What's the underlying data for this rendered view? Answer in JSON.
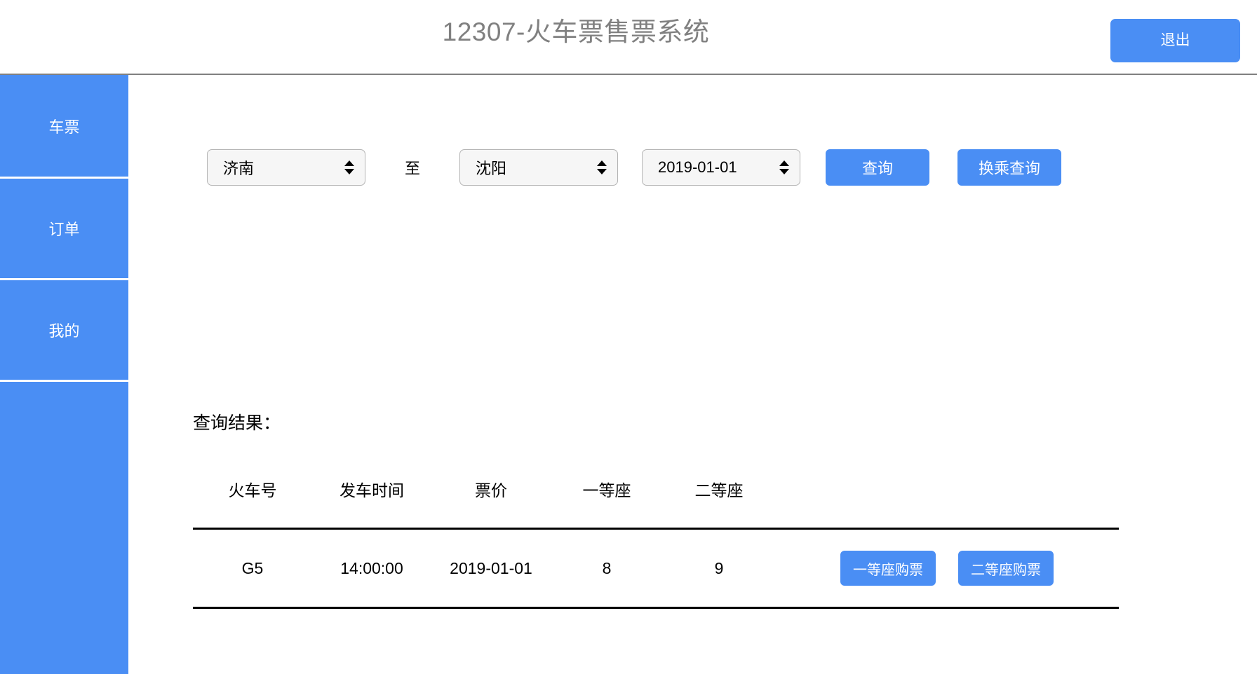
{
  "header": {
    "title": "12307-火车票售票系统",
    "logout_label": "退出"
  },
  "sidebar": {
    "items": [
      {
        "label": "车票"
      },
      {
        "label": "订单"
      },
      {
        "label": "我的"
      },
      {
        "label": ""
      }
    ]
  },
  "search": {
    "origin": "济南",
    "to_label": "至",
    "destination": "沈阳",
    "date": "2019-01-01",
    "query_label": "查询",
    "transfer_query_label": "换乘查询"
  },
  "results": {
    "label": "查询结果：",
    "columns": [
      "火车号",
      "发车时间",
      "票价",
      "一等座",
      "二等座",
      ""
    ],
    "rows": [
      {
        "train_no": "G5",
        "depart_time": "14:00:00",
        "price": "2019-01-01",
        "first_class": "8",
        "second_class": "9",
        "buy_first_label": "一等座购票",
        "buy_second_label": "二等座购票"
      }
    ]
  },
  "colors": {
    "accent": "#4a8ef4",
    "title_gray": "#808080",
    "select_bg": "#f6f6f6",
    "select_border": "#b4b4b4",
    "rule": "#000000"
  }
}
